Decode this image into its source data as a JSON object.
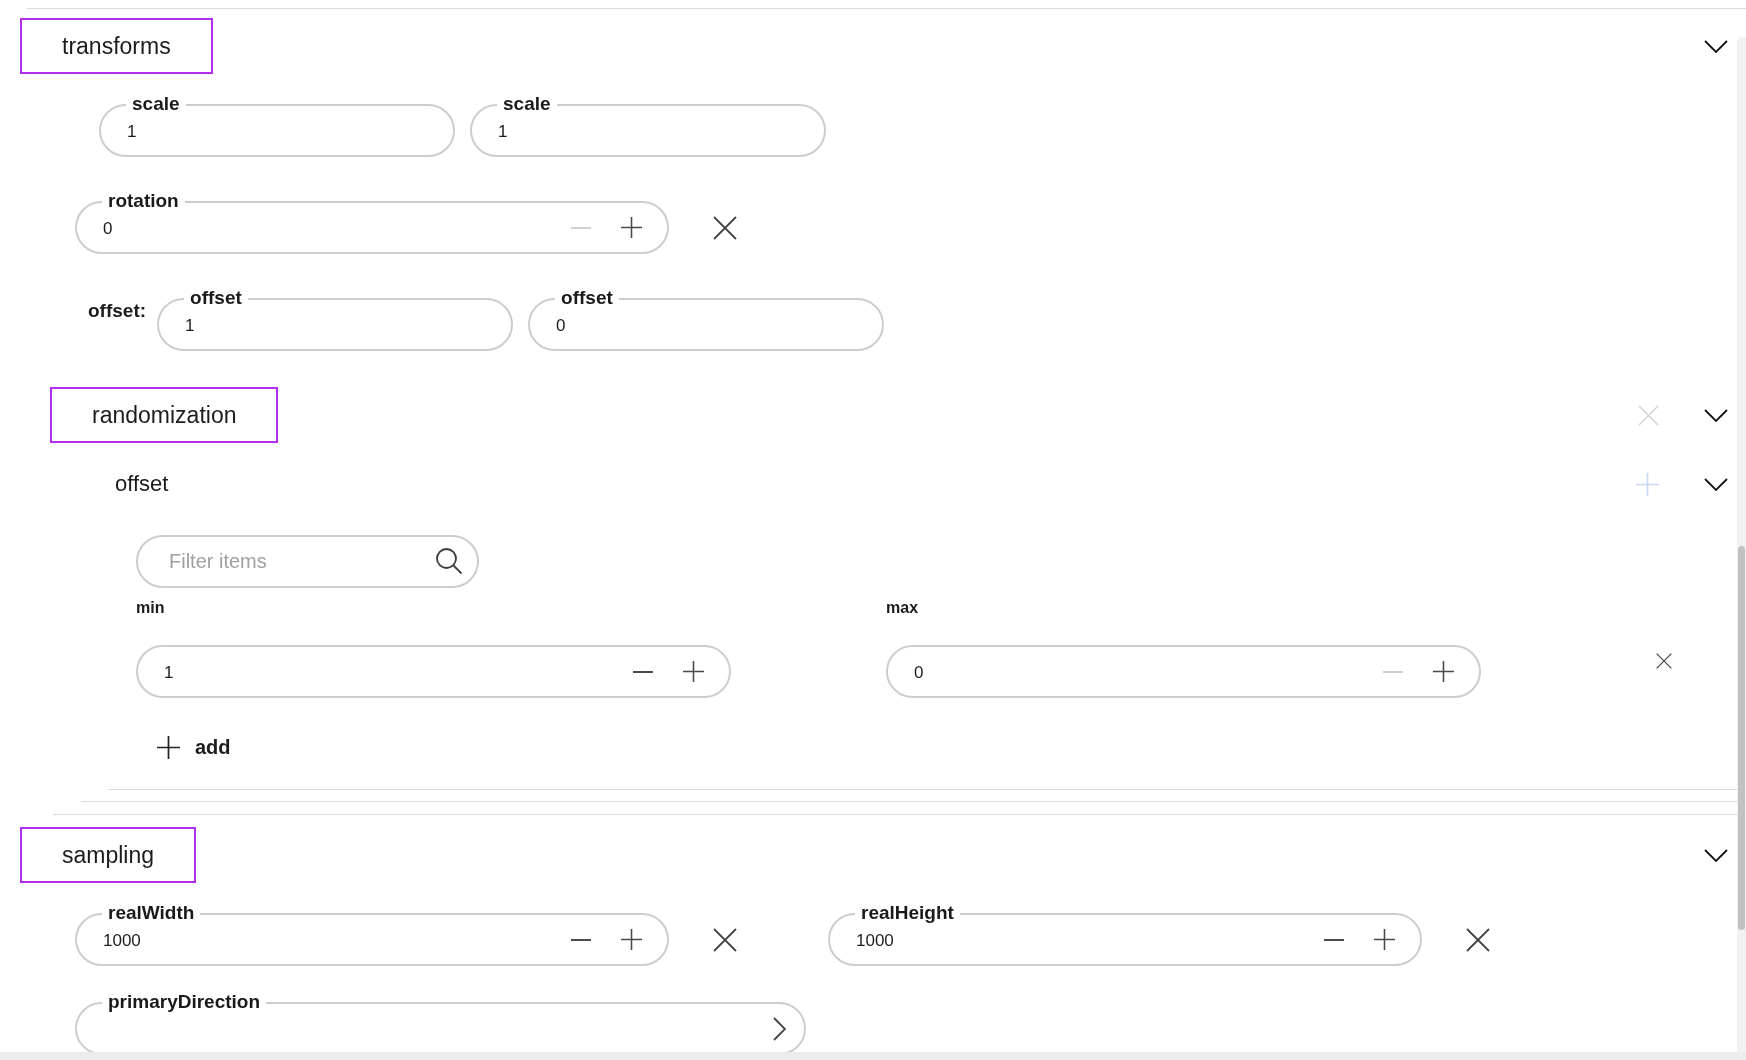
{
  "sections": [
    {
      "kind": "fields",
      "title": "transforms",
      "expanded": true,
      "rows": [
        {
          "fields": [
            {
              "kind": "text",
              "label": "scale",
              "value": "1",
              "removable": false
            },
            {
              "kind": "text",
              "label": "scale",
              "value": "1",
              "removable": false
            }
          ]
        },
        {
          "fields": [
            {
              "kind": "number",
              "label": "rotation",
              "value": "0",
              "decrement_disabled": true,
              "removable": true
            }
          ]
        },
        {
          "prefix": "offset:",
          "fields": [
            {
              "kind": "text",
              "label": "offset",
              "value": "1",
              "removable": false
            },
            {
              "kind": "text",
              "label": "offset",
              "value": "0",
              "removable": false
            }
          ]
        }
      ]
    },
    {
      "kind": "collection",
      "title": "randomization",
      "expanded": true,
      "remove_button": {
        "disabled": true
      },
      "groups": [
        {
          "title": "offset",
          "expanded": true,
          "add_button": {
            "disabled": true
          },
          "filter": {
            "placeholder": "Filter items"
          },
          "columns": [
            "min",
            "max"
          ],
          "entries": [
            {
              "values": [
                {
                  "value": "1",
                  "decrement_disabled": false
                },
                {
                  "value": "0",
                  "decrement_disabled": true
                }
              ]
            }
          ],
          "add_label": "add"
        }
      ]
    },
    {
      "kind": "fields",
      "title": "sampling",
      "expanded": true,
      "rows": [
        {
          "fields": [
            {
              "kind": "number",
              "label": "realWidth",
              "value": "1000",
              "decrement_disabled": false,
              "removable": true
            },
            {
              "kind": "number",
              "label": "realHeight",
              "value": "1000",
              "decrement_disabled": false,
              "removable": true
            }
          ]
        },
        {
          "fields": [
            {
              "kind": "select",
              "label": "primaryDirection",
              "removable": false
            }
          ]
        }
      ]
    }
  ]
}
